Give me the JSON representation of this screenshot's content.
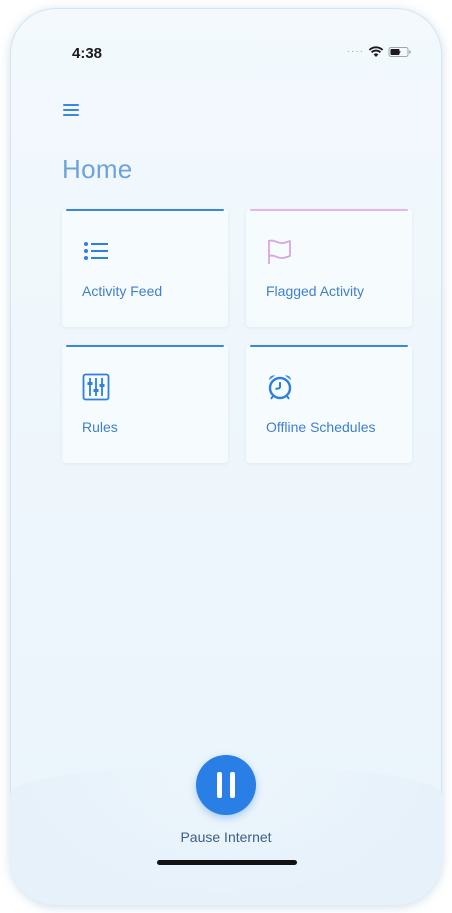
{
  "status_bar": {
    "time": "4:38",
    "signal_icon": "cellular-dots-icon",
    "wifi_icon": "wifi-icon",
    "battery_icon": "battery-charging-icon"
  },
  "header": {
    "menu_icon": "hamburger-menu-icon",
    "title": "Home"
  },
  "tiles": [
    {
      "label": "Activity Feed",
      "icon": "list-icon",
      "accent": "#3a86e0"
    },
    {
      "label": "Flagged Activity",
      "icon": "flag-icon",
      "accent": "#e3b7e6"
    },
    {
      "label": "Rules",
      "icon": "sliders-icon",
      "accent": "#3a86e0"
    },
    {
      "label": "Offline Schedules",
      "icon": "alarm-clock-icon",
      "accent": "#3a86e0"
    }
  ],
  "pause": {
    "icon": "pause-icon",
    "label": "Pause Internet"
  },
  "colors": {
    "accent": "#2a7fe6",
    "title": "#6ea3da",
    "flag": "#d9a6e0",
    "background": "#eef6fc"
  }
}
